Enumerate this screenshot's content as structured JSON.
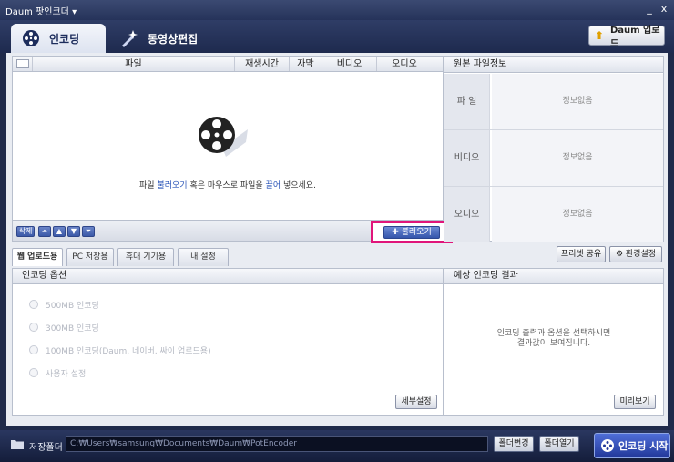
{
  "window": {
    "title": "Daum 팟인코더",
    "menu_arrow": "▾",
    "minimize": "_",
    "close": "x"
  },
  "tabs": [
    {
      "label": "인코딩",
      "icon": "film-reel-icon",
      "active": true
    },
    {
      "label": "동영상편집",
      "icon": "sparkle-edit-icon",
      "active": false
    }
  ],
  "header": {
    "upload_label": "Daum 업로드",
    "upload_icon": "arrow-up-icon"
  },
  "file_list": {
    "columns": [
      "파일",
      "재생시간",
      "자막",
      "비디오",
      "오디오"
    ],
    "hint_pre": "파일 ",
    "hint_link1": "불러오기",
    "hint_mid": " 혹은 마우스로 파일을 ",
    "hint_link2": "끌어",
    "hint_post": " 넣으세요.",
    "delete_label": "삭제",
    "load_label": "불러오기"
  },
  "source_info": {
    "title": "원본 파일정보",
    "rows": [
      {
        "key": "파  일",
        "value": "정보없음"
      },
      {
        "key": "비디오",
        "value": "정보없음"
      },
      {
        "key": "오디오",
        "value": "정보없음"
      }
    ]
  },
  "subtabs": [
    {
      "label": "웹 업로드용",
      "active": true
    },
    {
      "label": "PC 저장용",
      "active": false
    },
    {
      "label": "휴대 기기용",
      "active": false
    },
    {
      "label": "내 설정",
      "active": false
    }
  ],
  "preset_share_label": "프리셋 공유",
  "env_settings_label": "환경설정",
  "encoding_options": {
    "title": "인코딩 옵션",
    "options": [
      "500MB 인코딩",
      "300MB 인코딩",
      "100MB 인코딩(Daum, 네이버, 싸이 업로드용)",
      "사용자 설정"
    ],
    "detail_label": "세부설정"
  },
  "expected": {
    "title": "예상 인코딩 결과",
    "text_line1": "인코딩 출력과 옵션을 선택하시면",
    "text_line2": "결과값이 보여집니다.",
    "preview_label": "미리보기"
  },
  "bottom": {
    "save_folder_label": "저장폴더",
    "path": "C:₩Users₩samsung₩Documents₩Daum₩PotEncoder",
    "change_folder_label": "폴더변경",
    "open_folder_label": "폴더열기",
    "start_label": "인코딩 시작"
  },
  "colors": {
    "accent": "#2a54b8",
    "highlight_border": "#e0157a",
    "title_bg": "#26335a"
  }
}
